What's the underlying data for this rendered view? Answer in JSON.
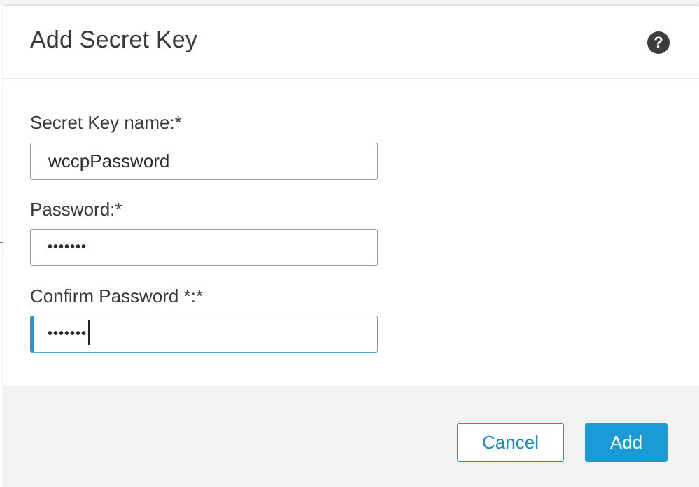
{
  "dialog": {
    "title": "Add Secret Key",
    "help_icon": "help-icon",
    "help_glyph": "?"
  },
  "form": {
    "secret_key_name": {
      "label": "Secret Key name:*",
      "value": "wccpPassword"
    },
    "password": {
      "label": "Password:*",
      "masked_value": "•••••••"
    },
    "confirm_password": {
      "label": "Confirm Password *:*",
      "masked_value": "•••••••"
    }
  },
  "footer": {
    "cancel_label": "Cancel",
    "add_label": "Add"
  },
  "colors": {
    "accent": "#1b9ad6",
    "help_icon_bg": "#3d3d3d",
    "footer_bg": "#f2f2f2"
  }
}
